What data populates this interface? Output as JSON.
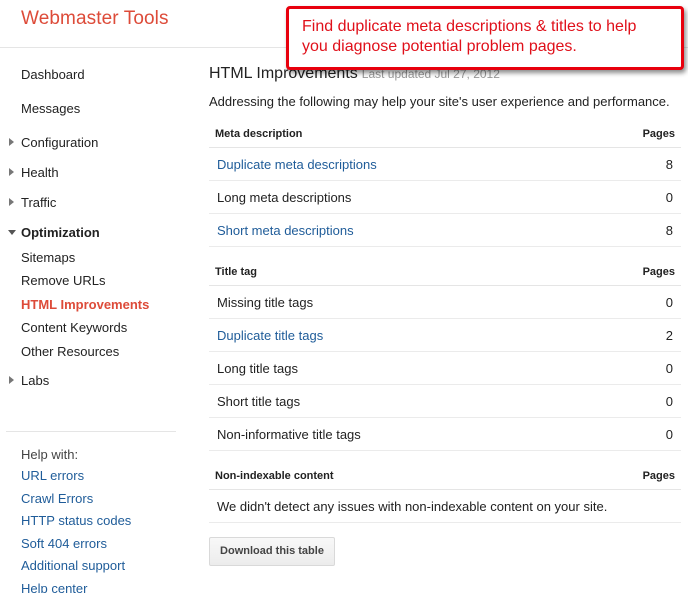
{
  "app": {
    "title": "Webmaster Tools"
  },
  "callout": {
    "line1": "Find duplicate meta descriptions & titles to help",
    "line2": "you diagnose potential problem pages."
  },
  "sidebar": {
    "items": [
      {
        "label": "Dashboard"
      },
      {
        "label": "Messages"
      },
      {
        "label": "Configuration"
      },
      {
        "label": "Health"
      },
      {
        "label": "Traffic"
      },
      {
        "label": "Optimization"
      },
      {
        "label": "Sitemaps"
      },
      {
        "label": "Remove URLs"
      },
      {
        "label": "HTML Improvements"
      },
      {
        "label": "Content Keywords"
      },
      {
        "label": "Other Resources"
      },
      {
        "label": "Labs"
      }
    ],
    "help_title": "Help with:",
    "help_links": [
      {
        "label": "URL errors"
      },
      {
        "label": "Crawl Errors"
      },
      {
        "label": "HTTP status codes"
      },
      {
        "label": "Soft 404 errors"
      },
      {
        "label": "Additional support"
      },
      {
        "label": "Help center"
      }
    ]
  },
  "main": {
    "title": "HTML Improvements",
    "updated": "Last updated Jul 27, 2012",
    "intro": "Addressing the following may help your site's user experience and performance.",
    "pages_header": "Pages",
    "sections": [
      {
        "header": "Meta description",
        "rows": [
          {
            "label": "Duplicate meta descriptions",
            "count": "8"
          },
          {
            "label": "Long meta descriptions",
            "count": "0"
          },
          {
            "label": "Short meta descriptions",
            "count": "8"
          }
        ]
      },
      {
        "header": "Title tag",
        "rows": [
          {
            "label": "Missing title tags",
            "count": "0"
          },
          {
            "label": "Duplicate title tags",
            "count": "2"
          },
          {
            "label": "Long title tags",
            "count": "0"
          },
          {
            "label": "Short title tags",
            "count": "0"
          },
          {
            "label": "Non-informative title tags",
            "count": "0"
          }
        ]
      },
      {
        "header": "Non-indexable content",
        "message": "We didn't detect any issues with non-indexable content on your site."
      }
    ],
    "download_label": "Download this table"
  },
  "colors": {
    "brand": "#dd4b39",
    "link": "#1f5c99",
    "callout": "#e8000d"
  }
}
